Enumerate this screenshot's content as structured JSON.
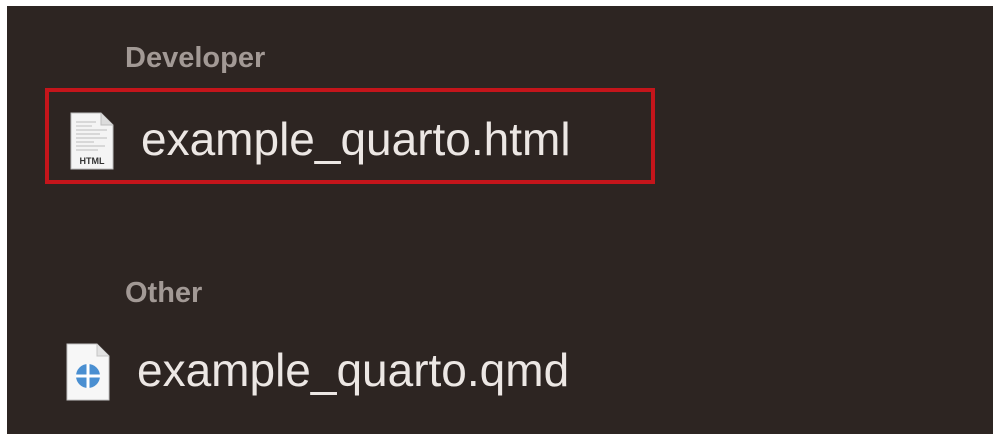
{
  "sections": [
    {
      "header": "Developer",
      "files": [
        {
          "name": "example_quarto.html",
          "icon": "html-document-icon",
          "icon_label": "HTML",
          "selected": true
        }
      ]
    },
    {
      "header": "Other",
      "files": [
        {
          "name": "example_quarto.qmd",
          "icon": "quarto-document-icon",
          "selected": false
        }
      ]
    }
  ],
  "colors": {
    "background": "#2d2522",
    "header_text": "#a29995",
    "file_text": "#ece7e4",
    "selection_outline": "#c4151b",
    "quarto_blue": "#4a8fd1"
  }
}
